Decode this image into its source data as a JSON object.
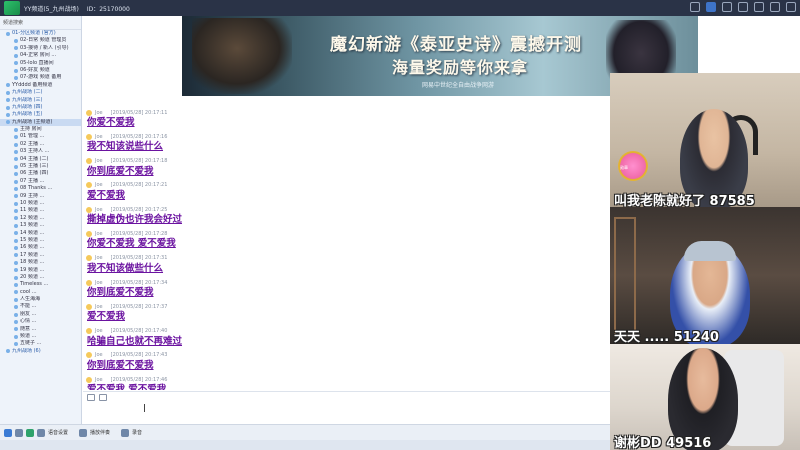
{
  "titlebar": {
    "text1": "YY频道(5_九州战场)",
    "text2": "ID：25170000"
  },
  "tree": {
    "header": "频道搜索",
    "rows": [
      {
        "label": "01-分区频道 (官方)",
        "cls": "ch"
      },
      {
        "label": "02-日常 频道 管理员",
        "cls": "sub"
      },
      {
        "label": "03-接待 / 新人 (引导)",
        "cls": "sub"
      },
      {
        "label": "04-正常 房间 ...",
        "cls": "sub"
      },
      {
        "label": "05-lolo 直播间",
        "cls": "sub"
      },
      {
        "label": "06-好友 频道",
        "cls": "sub"
      },
      {
        "label": "07-游戏 频道 备用",
        "cls": "sub"
      },
      {
        "label": "YYdddd 备用频道",
        "cls": ""
      },
      {
        "label": "九州战场 (二)",
        "cls": "ch"
      },
      {
        "label": "九州战场 (三)",
        "cls": "ch"
      },
      {
        "label": "九州战场 (四)",
        "cls": "ch"
      },
      {
        "label": "九州战场 (五)",
        "cls": "ch"
      },
      {
        "label": "九州战场 (主频道)",
        "cls": "sel"
      },
      {
        "label": "主持 房间",
        "cls": "sub"
      },
      {
        "label": "01 管理 ...",
        "cls": "sub"
      },
      {
        "label": "02 主播 ...",
        "cls": "sub"
      },
      {
        "label": "03 主持人 ...",
        "cls": "sub"
      },
      {
        "label": "04 主播 (二)",
        "cls": "sub"
      },
      {
        "label": "05 主播 (三)",
        "cls": "sub"
      },
      {
        "label": "06 主播 (四)",
        "cls": "sub"
      },
      {
        "label": "07 主播 ...",
        "cls": "sub"
      },
      {
        "label": "08 Thanks ...",
        "cls": "sub"
      },
      {
        "label": "09 主持 ...",
        "cls": "sub"
      },
      {
        "label": "10 频道 ...",
        "cls": "sub"
      },
      {
        "label": "11 频道 ...",
        "cls": "sub"
      },
      {
        "label": "12 频道 ...",
        "cls": "sub"
      },
      {
        "label": "13 频道 ...",
        "cls": "sub"
      },
      {
        "label": "14 频道 ...",
        "cls": "sub"
      },
      {
        "label": "15 频道 ...",
        "cls": "sub"
      },
      {
        "label": "16 频道 ...",
        "cls": "sub"
      },
      {
        "label": "17 频道 ...",
        "cls": "sub"
      },
      {
        "label": "18 频道 ...",
        "cls": "sub"
      },
      {
        "label": "19 频道 ...",
        "cls": "sub"
      },
      {
        "label": "20 频道 ...",
        "cls": "sub"
      },
      {
        "label": "Timeless ...",
        "cls": "sub"
      },
      {
        "label": "cool ...",
        "cls": "sub"
      },
      {
        "label": "人生海海",
        "cls": "sub"
      },
      {
        "label": "不能 ...",
        "cls": "sub"
      },
      {
        "label": "朋友 ...",
        "cls": "sub"
      },
      {
        "label": "心情 ...",
        "cls": "sub"
      },
      {
        "label": "随意 ...",
        "cls": "sub"
      },
      {
        "label": "频道 ...",
        "cls": "sub"
      },
      {
        "label": "五链子 ...",
        "cls": "sub"
      },
      {
        "label": "九州战场 (6)",
        "cls": "ch"
      }
    ]
  },
  "banner": {
    "title": "魔幻新游《泰亚史诗》震撼开测",
    "subtitle": "海量奖励等你来拿",
    "tagline": "网易中世纪全自由战争网游"
  },
  "chat": {
    "sender": "Joe",
    "messages": [
      {
        "time": "[2019/05/28] 20:17:11",
        "text": "你爱不爱我"
      },
      {
        "time": "[2019/05/28] 20:17:16",
        "text": "我不知该说些什么"
      },
      {
        "time": "[2019/05/28] 20:17:18",
        "text": "你到底爱不爱我"
      },
      {
        "time": "[2019/05/28] 20:17:21",
        "text": "爱不爱我"
      },
      {
        "time": "[2019/05/28] 20:17:25",
        "text": "撕掉虚伪也许我会好过"
      },
      {
        "time": "[2019/05/28] 20:17:28",
        "text": "你爱不爱我 爱不爱我"
      },
      {
        "time": "[2019/05/28] 20:17:31",
        "text": "我不知该做些什么"
      },
      {
        "time": "[2019/05/28] 20:17:34",
        "text": "你到底爱不爱我"
      },
      {
        "time": "[2019/05/28] 20:17:37",
        "text": "爱不爱我"
      },
      {
        "time": "[2019/05/28] 20:17:40",
        "text": "哈骗自己也就不再难过"
      },
      {
        "time": "[2019/05/28] 20:17:43",
        "text": "你到底爱不爱我"
      },
      {
        "time": "[2019/05/28] 20:17:46",
        "text": "爱不爱我 爱不爱我"
      }
    ]
  },
  "bottombar": {
    "items": [
      "语音设置",
      "播放伴奏",
      "录音"
    ]
  },
  "cams": [
    {
      "label": "叫我老陈就好了 87585",
      "medal": "勋章"
    },
    {
      "label": "天天 ..... 51240"
    },
    {
      "label": "谢彬DD 49516"
    }
  ]
}
